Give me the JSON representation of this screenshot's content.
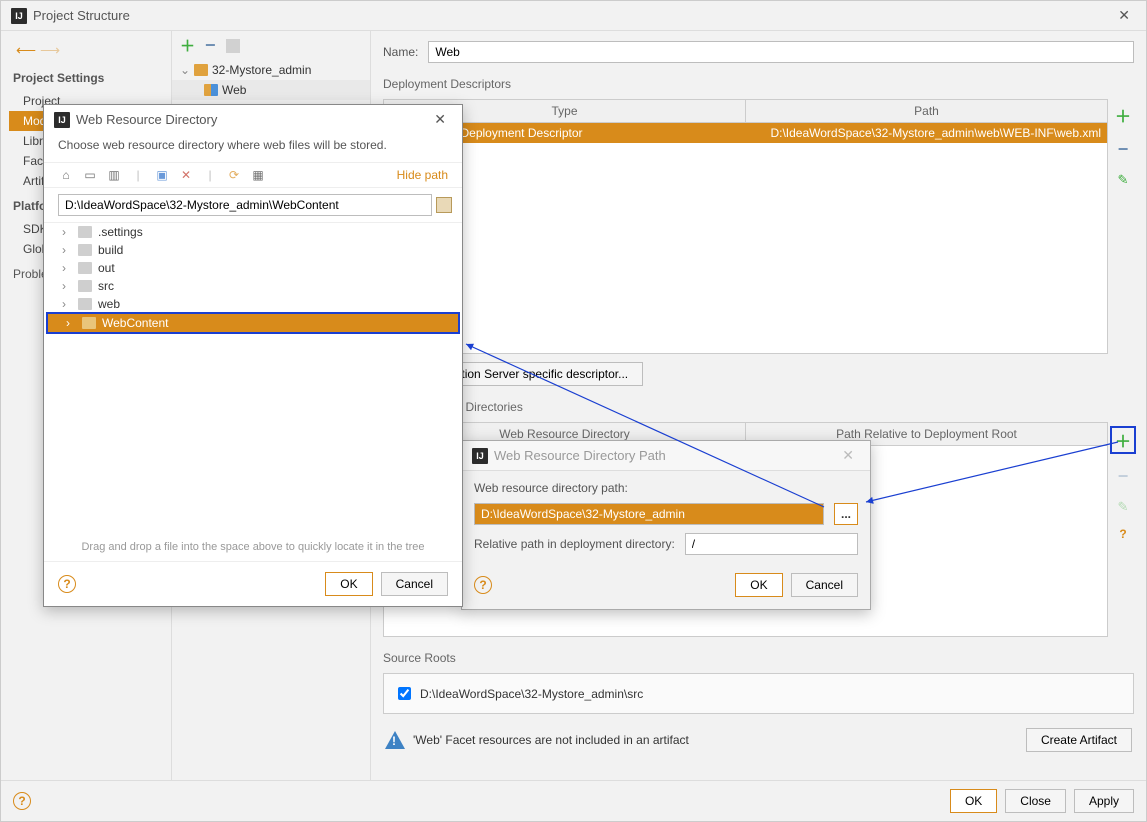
{
  "window": {
    "title": "Project Structure"
  },
  "sidebar": {
    "section1": "Project Settings",
    "items1": [
      "Project",
      "Modules",
      "Libraries",
      "Facets",
      "Artifacts"
    ],
    "section2": "Platform Settings",
    "items2": [
      "SDKs",
      "Global Libraries"
    ],
    "section3": "Problems"
  },
  "tree": {
    "root": "32-Mystore_admin",
    "child": "Web"
  },
  "name_label": "Name:",
  "name_value": "Web",
  "deploy_title": "Deployment Descriptors",
  "deploy_table": {
    "headers": [
      "Type",
      "Path"
    ],
    "row": [
      "Web Module Deployment Descriptor",
      "D:\\IdeaWordSpace\\32-Mystore_admin\\web\\WEB-INF\\web.xml"
    ]
  },
  "add_descriptor_btn": "Add Application Server specific descriptor...",
  "webres_title": "Web Resource Directories",
  "webres_headers": [
    "Web Resource Directory",
    "Path Relative to Deployment Root"
  ],
  "source_roots_title": "Source Roots",
  "source_root_value": "D:\\IdeaWordSpace\\32-Mystore_admin\\src",
  "warning": "'Web' Facet resources are not included in an artifact",
  "create_artifact_btn": "Create Artifact",
  "footer": {
    "ok": "OK",
    "close": "Close",
    "apply": "Apply"
  },
  "dlg2": {
    "title": "Web Resource Directory Path",
    "label1": "Web resource directory path:",
    "value1": "D:\\IdeaWordSpace\\32-Mystore_admin",
    "browse": "...",
    "label2": "Relative path in deployment directory:",
    "value2": "/",
    "ok": "OK",
    "cancel": "Cancel"
  },
  "dlg1": {
    "title": "Web Resource Directory",
    "msg": "Choose web resource directory where web files will be stored.",
    "hide_path": "Hide path",
    "path": "D:\\IdeaWordSpace\\32-Mystore_admin\\WebContent",
    "nodes": [
      ".settings",
      "build",
      "out",
      "src",
      "web",
      "WebContent"
    ],
    "hint": "Drag and drop a file into the space above to quickly locate it in the tree",
    "ok": "OK",
    "cancel": "Cancel"
  }
}
